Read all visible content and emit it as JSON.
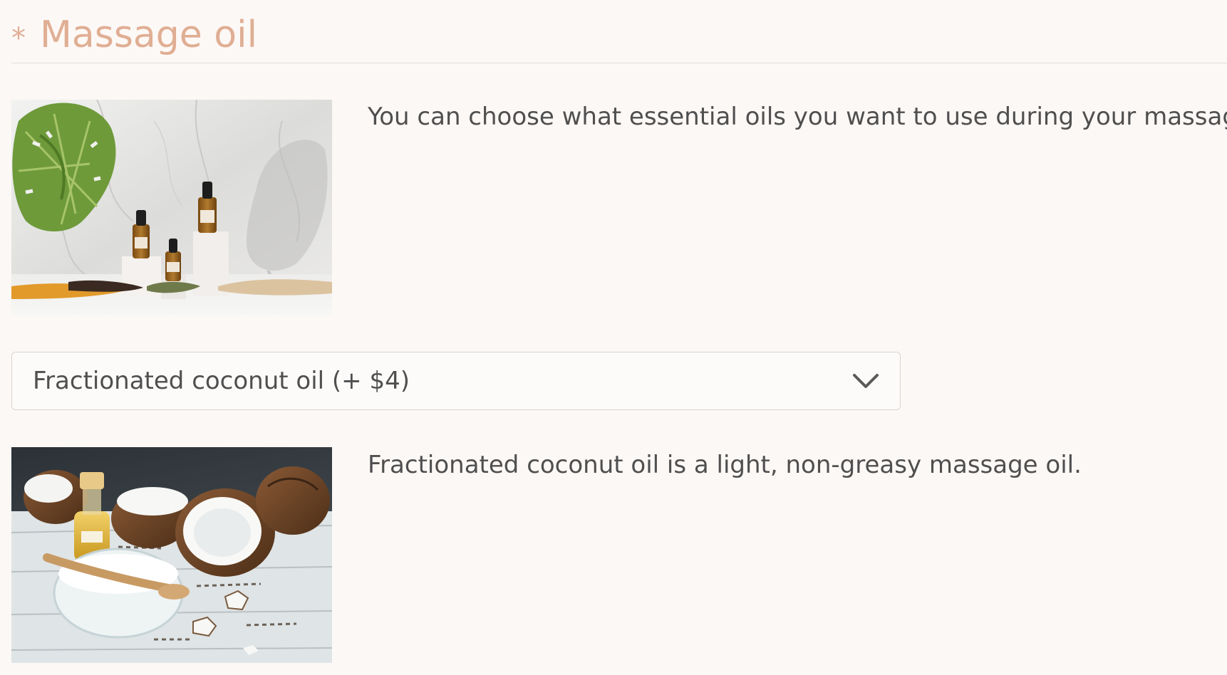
{
  "section": {
    "required_mark": "*",
    "title": "Massage oil"
  },
  "intro": {
    "image": "essential-oil-bottles-photo",
    "text": "You can choose what essential oils you want to use during your massage."
  },
  "oil_select": {
    "selected_label": "Fractionated coconut oil (+ $4)",
    "icon": "chevron-down-icon"
  },
  "selected_option": {
    "image": "coconut-oil-photo",
    "description": "Fractionated coconut oil is a light, non-greasy massage oil."
  },
  "colors": {
    "background": "#fcf8f6",
    "accent": "#e0ae93",
    "text": "#4f4f4f",
    "border": "#d9d4d1"
  }
}
